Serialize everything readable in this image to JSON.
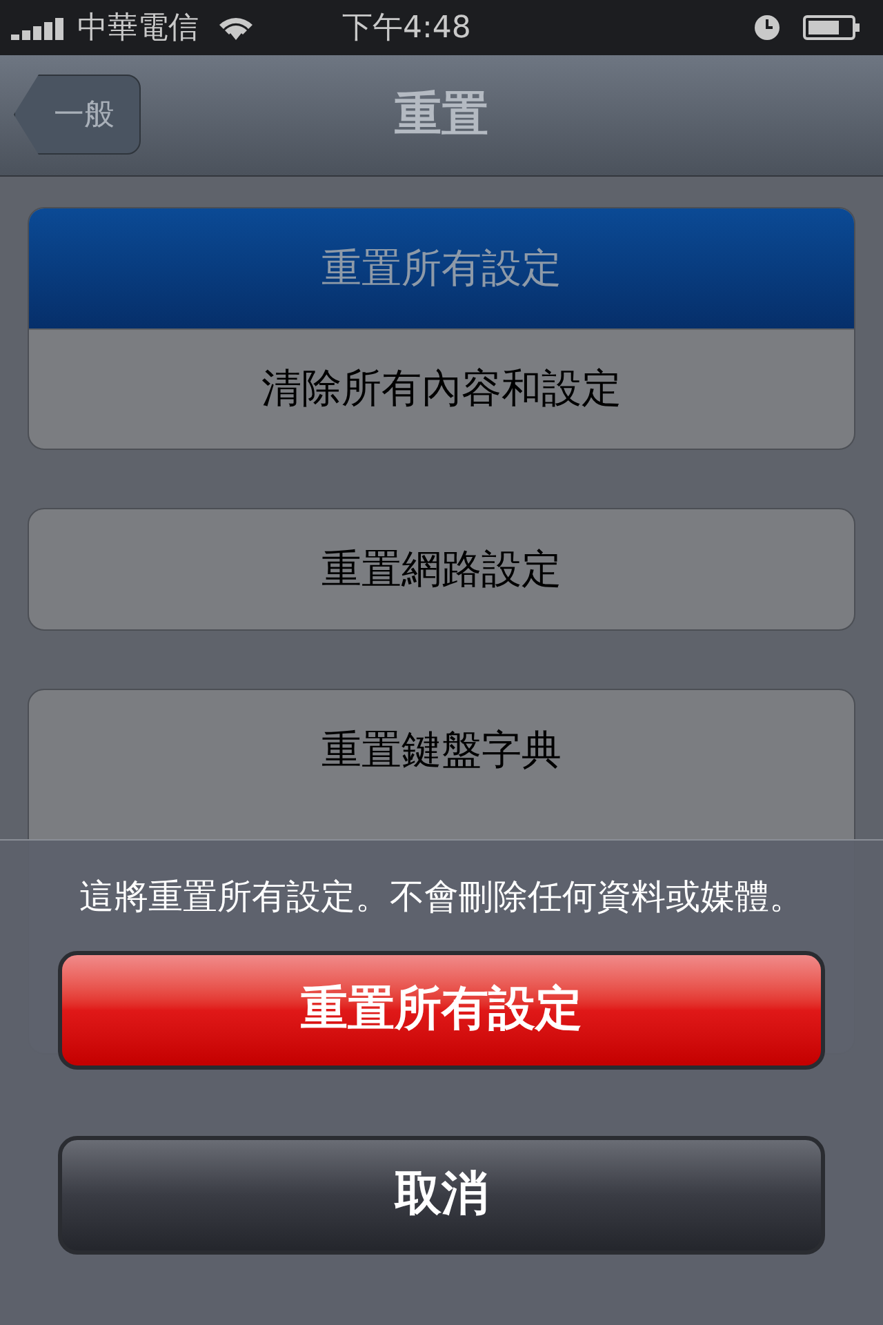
{
  "status_bar": {
    "carrier": "中華電信",
    "time": "下午4:48"
  },
  "nav": {
    "back": "一般",
    "title": "重置"
  },
  "groups": [
    {
      "rows": [
        {
          "label": "重置所有設定",
          "selected": true
        },
        {
          "label": "清除所有內容和設定",
          "selected": false
        }
      ]
    },
    {
      "rows": [
        {
          "label": "重置網路設定",
          "selected": false
        }
      ]
    },
    {
      "rows": [
        {
          "label": "重置鍵盤字典",
          "selected": false
        }
      ]
    }
  ],
  "action_sheet": {
    "message": "這將重置所有設定。不會刪除任何資料或媒體。",
    "buttons": [
      {
        "label": "重置所有設定",
        "kind": "destructive"
      },
      {
        "label": "取消",
        "kind": "cancel"
      }
    ]
  }
}
